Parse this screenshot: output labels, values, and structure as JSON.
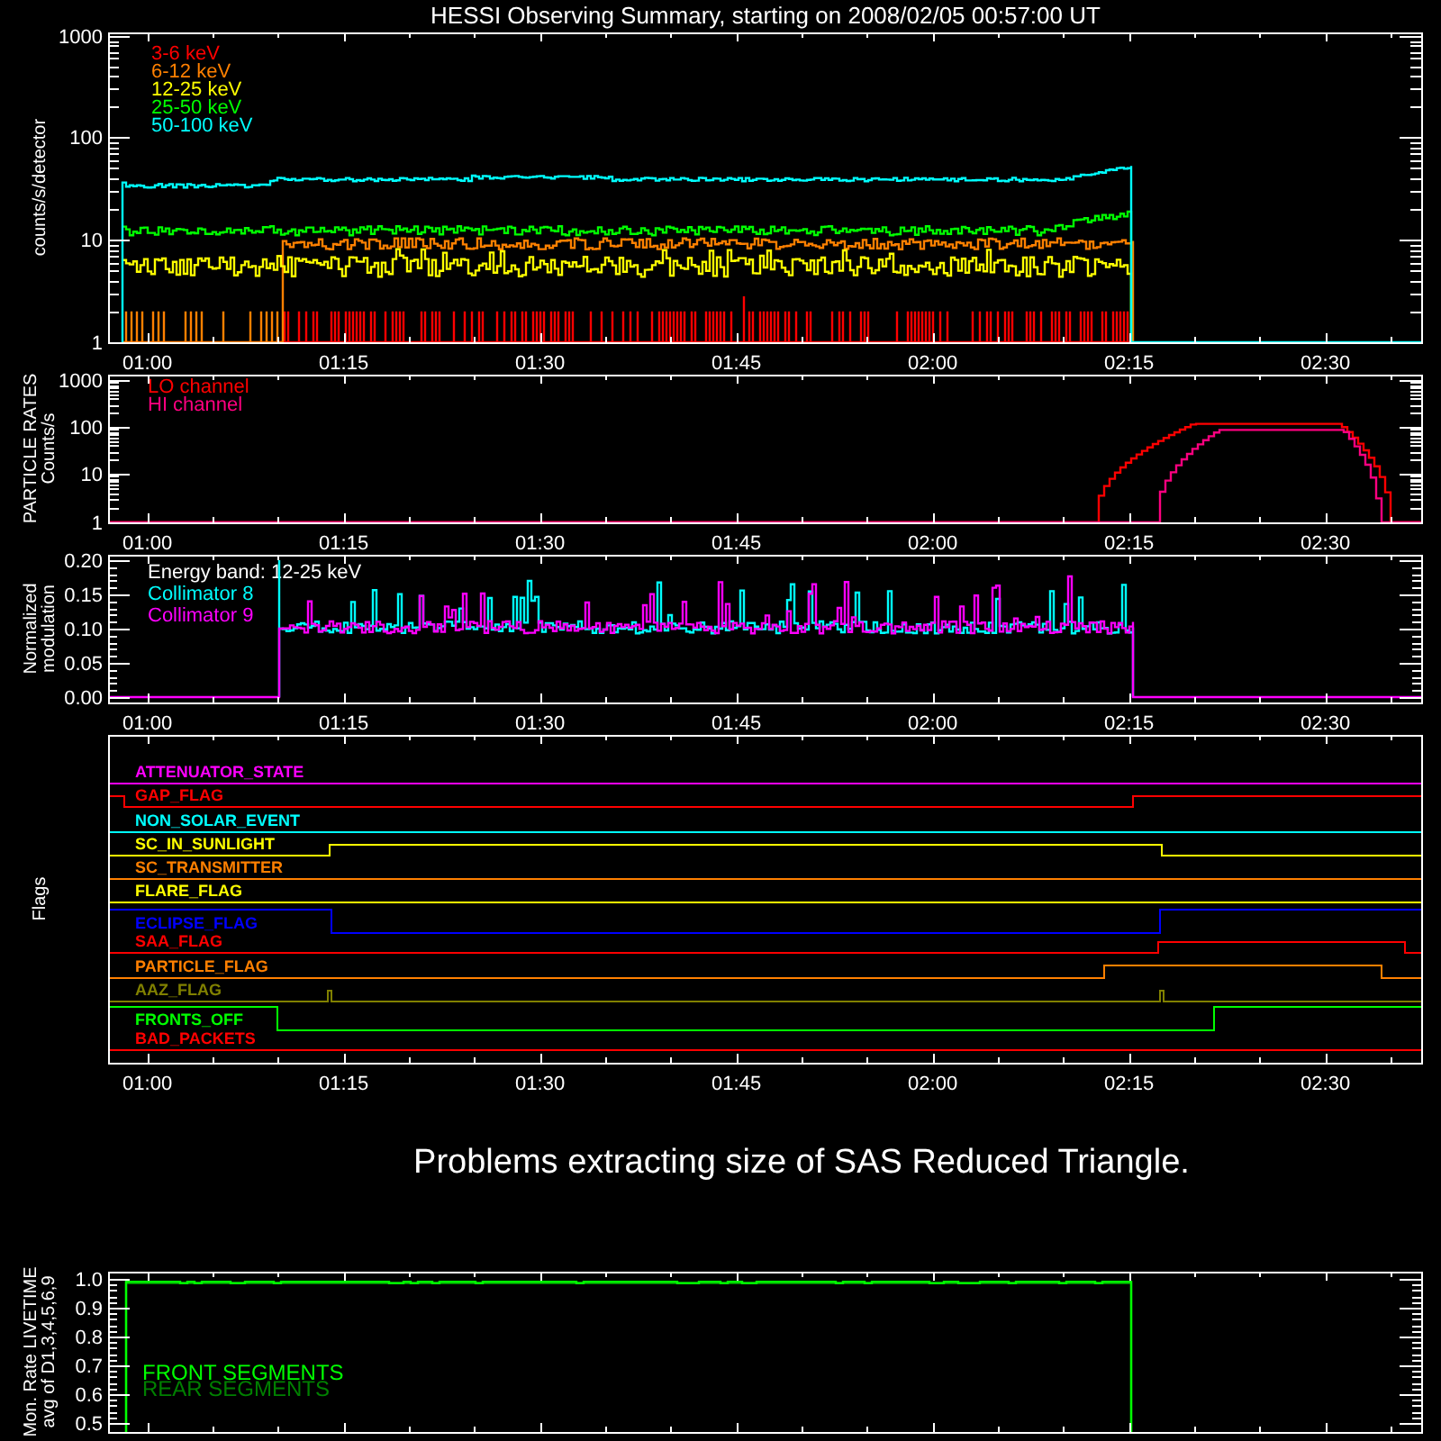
{
  "title": "HESSI Observing Summary, starting on 2008/02/05 00:57:00 UT",
  "panels": [
    {
      "kind": "spectrum",
      "ylabel": [
        "counts/s/detector"
      ],
      "yticks": [
        "1000",
        "100",
        "10",
        "1"
      ],
      "xticks": [
        "01:00",
        "01:15",
        "01:30",
        "01:45",
        "02:00",
        "02:15",
        "02:30"
      ],
      "legend": [
        {
          "label": "3-6 keV",
          "color": "#ff0000"
        },
        {
          "label": "6-12 keV",
          "color": "#ff8000"
        },
        {
          "label": "12-25 keV",
          "color": "#ffff00"
        },
        {
          "label": "25-50 keV",
          "color": "#00ff00"
        },
        {
          "label": "50-100 keV",
          "color": "#00ffff"
        }
      ]
    },
    {
      "kind": "particle",
      "ylabel": [
        "PARTICLE RATES",
        "Counts/s"
      ],
      "yticks": [
        "1000",
        "100",
        "10",
        "1"
      ],
      "xticks": [
        "01:00",
        "01:15",
        "01:30",
        "01:45",
        "02:00",
        "02:15",
        "02:30"
      ],
      "legend": [
        {
          "label": "LO channel",
          "color": "#ff0000"
        },
        {
          "label": "HI channel",
          "color": "#ff0080"
        }
      ]
    },
    {
      "kind": "modulation",
      "ylabel": [
        "Normalized",
        "modulation"
      ],
      "yticks": [
        "0.20",
        "0.15",
        "0.10",
        "0.05",
        "0.00"
      ],
      "xticks": [
        "01:00",
        "01:15",
        "01:30",
        "01:45",
        "02:00",
        "02:15",
        "02:30"
      ],
      "legend_heading": "Energy band:  12-25 keV",
      "legend": [
        {
          "label": "Collimator 8",
          "color": "#00ffff"
        },
        {
          "label": "Collimator 9",
          "color": "#ff00ff"
        }
      ]
    },
    {
      "kind": "flags",
      "ylabel": [
        "Flags"
      ],
      "xticks": [
        "01:00",
        "01:15",
        "01:30",
        "01:45",
        "02:00",
        "02:15",
        "02:30"
      ],
      "flags": [
        {
          "label": "ATTENUATOR_STATE",
          "color": "#ff00ff"
        },
        {
          "label": "GAP_FLAG",
          "color": "#ff0000"
        },
        {
          "label": "NON_SOLAR_EVENT",
          "color": "#00ffff"
        },
        {
          "label": "SC_IN_SUNLIGHT",
          "color": "#ffff00"
        },
        {
          "label": "SC_TRANSMITTER",
          "color": "#ff8000"
        },
        {
          "label": "FLARE_FLAG",
          "color": "#ffff00"
        },
        {
          "label": "ECLIPSE_FLAG",
          "color": "#0000ff"
        },
        {
          "label": "SAA_FLAG",
          "color": "#ff0000"
        },
        {
          "label": "PARTICLE_FLAG",
          "color": "#ff8000"
        },
        {
          "label": "AAZ_FLAG",
          "color": "#808000"
        },
        {
          "label": "FRONTS_OFF",
          "color": "#00ff00"
        },
        {
          "label": "BAD_PACKETS",
          "color": "#ff0000"
        }
      ]
    },
    {
      "kind": "message",
      "text": "Problems extracting size of SAS Reduced Triangle."
    },
    {
      "kind": "livetime",
      "ylabel": [
        "Mon. Rate LIVETIME",
        "avg of D1,3,4,5,6,9"
      ],
      "yticks": [
        "1.0",
        "0.9",
        "0.8",
        "0.7",
        "0.6",
        "0.5"
      ],
      "legend": [
        {
          "label": "FRONT SEGMENTS",
          "color": "#00ff00"
        },
        {
          "label": "REAR SEGMENTS",
          "color": "#008000"
        }
      ]
    }
  ]
}
